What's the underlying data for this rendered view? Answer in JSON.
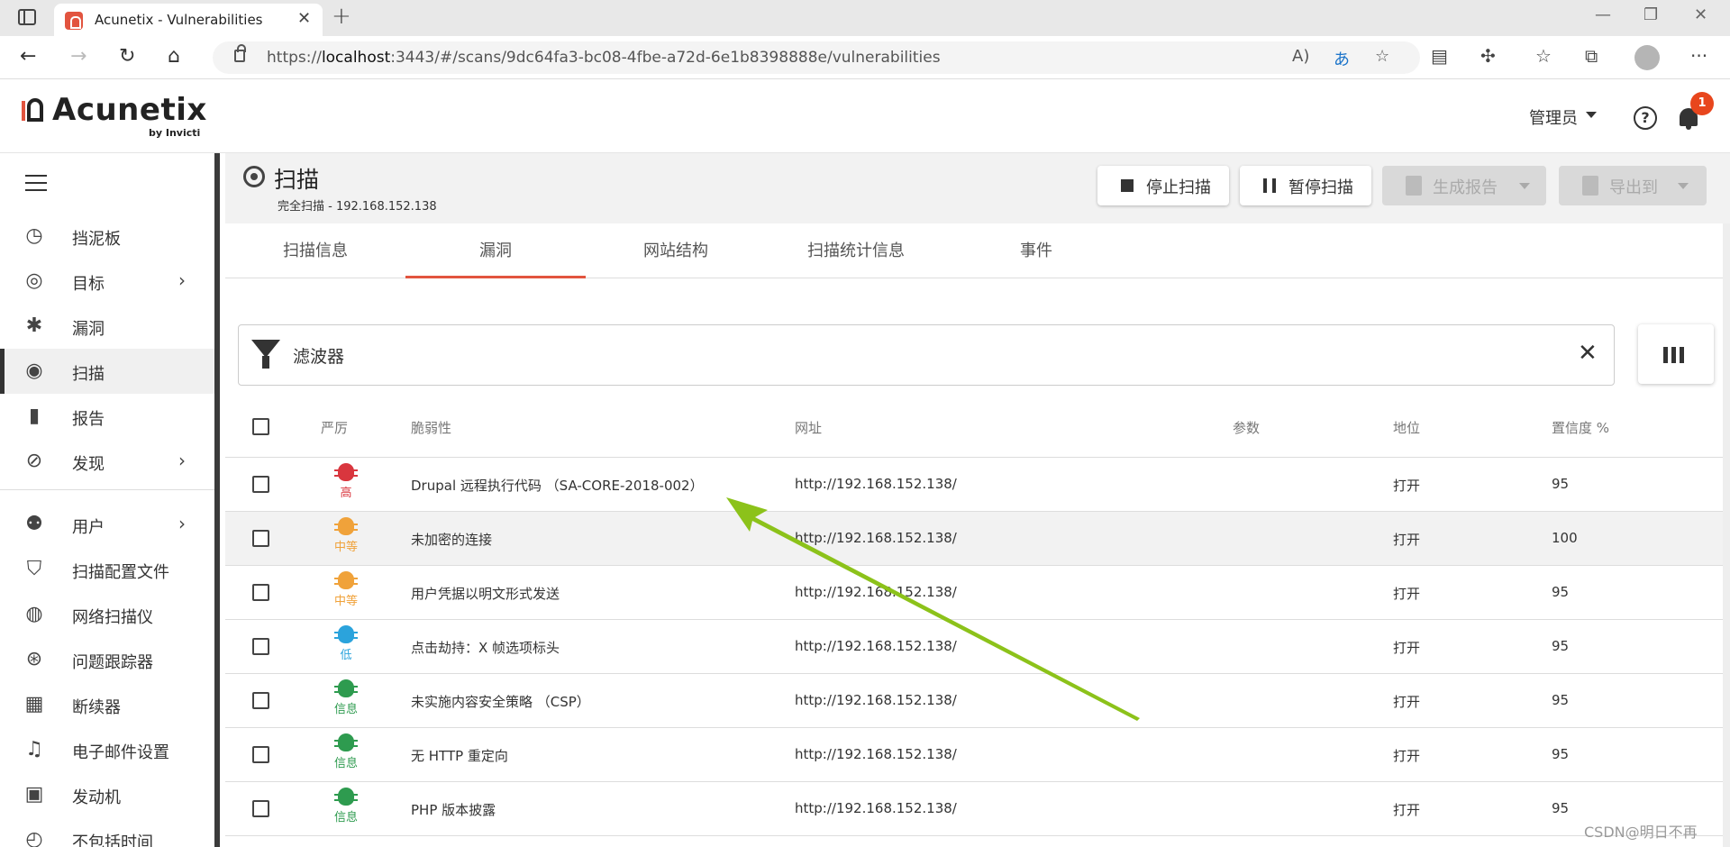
{
  "browser": {
    "tab_title": "Acunetix - Vulnerabilities",
    "url_prefix": "https://",
    "url_host": "localhost",
    "url_rest": ":3443/#/scans/9dc64fa3-bc08-4fbe-a72d-6e1b8398888e/vulnerabilities"
  },
  "header": {
    "logo": "Acunetix",
    "logo_sub": "by Invicti",
    "user": "管理员",
    "notification_count": "1"
  },
  "sidebar": {
    "items": [
      {
        "label": "挡泥板",
        "icon": "dashboard-icon",
        "glyph": "◷"
      },
      {
        "label": "目标",
        "icon": "target-icon",
        "glyph": "◎",
        "has_children": true
      },
      {
        "label": "漏洞",
        "icon": "bug-icon",
        "glyph": "✱"
      },
      {
        "label": "扫描",
        "icon": "scan-icon",
        "glyph": "◉",
        "active": true
      },
      {
        "label": "报告",
        "icon": "report-icon",
        "glyph": "▮"
      },
      {
        "label": "发现",
        "icon": "compass-icon",
        "glyph": "⊘",
        "has_children": true
      },
      {
        "label": "用户",
        "icon": "users-icon",
        "glyph": "⚉",
        "has_children": true
      },
      {
        "label": "扫描配置文件",
        "icon": "shield-icon",
        "glyph": "⛉"
      },
      {
        "label": "网络扫描仪",
        "icon": "network-scanner-icon",
        "glyph": "◍"
      },
      {
        "label": "问题跟踪器",
        "icon": "issue-tracker-icon",
        "glyph": "⊛"
      },
      {
        "label": "断续器",
        "icon": "firewall-icon",
        "glyph": "▦"
      },
      {
        "label": "电子邮件设置",
        "icon": "bell-icon",
        "glyph": "♫"
      },
      {
        "label": "发动机",
        "icon": "engine-icon",
        "glyph": "▣"
      },
      {
        "label": "不包括时间",
        "icon": "clock-icon",
        "glyph": "◴"
      }
    ]
  },
  "page": {
    "title": "扫描",
    "subtitle": "完全扫描 - 192.168.152.138",
    "buttons": {
      "stop": "停止扫描",
      "pause": "暂停扫描",
      "report": "生成报告",
      "export": "导出到"
    },
    "tabs": [
      "扫描信息",
      "漏洞",
      "网站结构",
      "扫描统计信息",
      "事件"
    ],
    "active_tab": 1
  },
  "filter": {
    "label": "滤波器"
  },
  "table": {
    "headers": {
      "severity": "严厉",
      "vulnerability": "脆弱性",
      "url": "网址",
      "params": "参数",
      "status": "地位",
      "confidence": "置信度 %"
    },
    "rows": [
      {
        "severity": "高",
        "color": "#d9363e",
        "name": "Drupal 远程执行代码 （SA-CORE-2018-002）",
        "url": "http://192.168.152.138/",
        "param": "",
        "status": "打开",
        "confidence": "95"
      },
      {
        "severity": "中等",
        "color": "#f0a23a",
        "name": "未加密的连接",
        "url": "http://192.168.152.138/",
        "param": "",
        "status": "打开",
        "confidence": "100"
      },
      {
        "severity": "中等",
        "color": "#f0a23a",
        "name": "用户凭据以明文形式发送",
        "url": "http://192.168.152.138/",
        "param": "",
        "status": "打开",
        "confidence": "95"
      },
      {
        "severity": "低",
        "color": "#2ba3dc",
        "name": "点击劫持：X 帧选项标头",
        "url": "http://192.168.152.138/",
        "param": "",
        "status": "打开",
        "confidence": "95"
      },
      {
        "severity": "信息",
        "color": "#2e9b4f",
        "name": "未实施内容安全策略 （CSP）",
        "url": "http://192.168.152.138/",
        "param": "",
        "status": "打开",
        "confidence": "95"
      },
      {
        "severity": "信息",
        "color": "#2e9b4f",
        "name": "无 HTTP 重定向",
        "url": "http://192.168.152.138/",
        "param": "",
        "status": "打开",
        "confidence": "95"
      },
      {
        "severity": "信息",
        "color": "#2e9b4f",
        "name": "PHP 版本披露",
        "url": "http://192.168.152.138/",
        "param": "",
        "status": "打开",
        "confidence": "95"
      }
    ]
  },
  "annotation": {
    "arrow_color": "#8cc21a"
  },
  "watermark": "CSDN@明日不再"
}
